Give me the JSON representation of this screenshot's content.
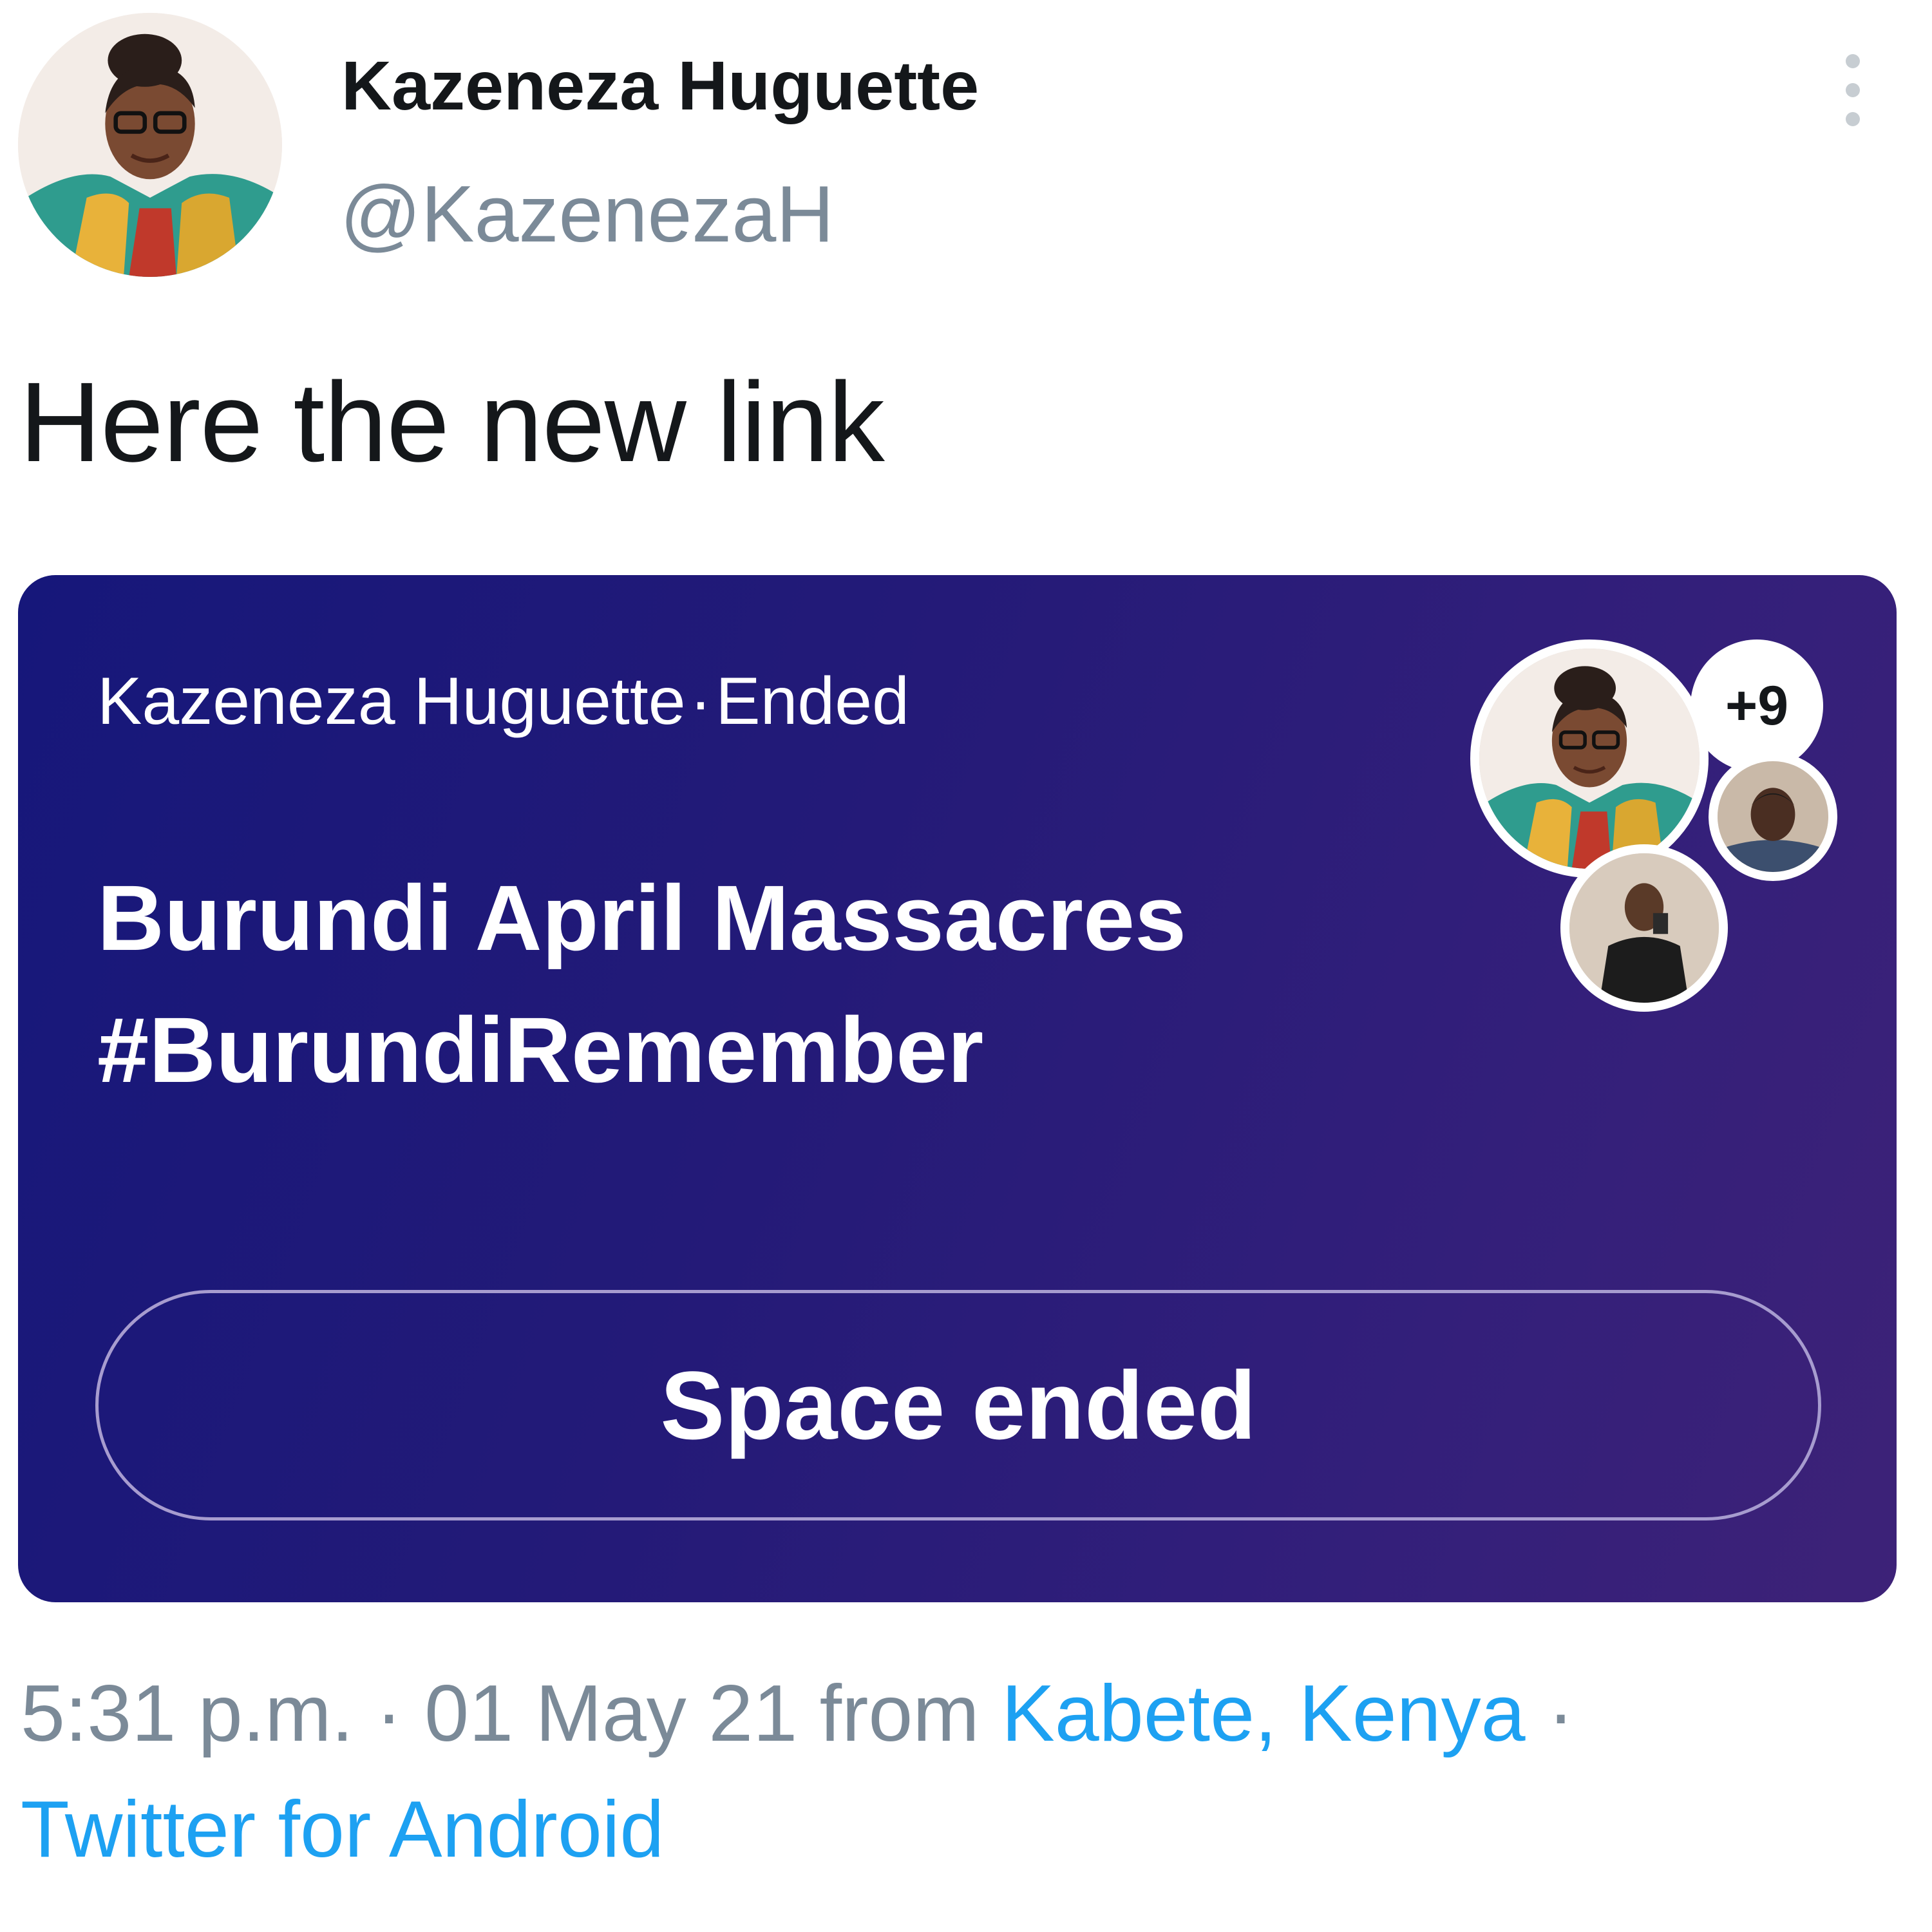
{
  "author": {
    "display_name": "Kazeneza Huguette",
    "handle": "@KazenezaH",
    "avatar_icon": "user-avatar-photo"
  },
  "tweet": {
    "text": "Here the new link"
  },
  "space_card": {
    "host_name": "Kazeneza Huguette",
    "separator": "·",
    "status": "Ended",
    "title_line1": "Burundi April Massacres",
    "title_line2": "#BurundiRemember",
    "extra_speakers_count": "+9",
    "button_label": "Space ended",
    "gradient_colors": [
      "#16177a",
      "#3d2278"
    ]
  },
  "footer": {
    "time": "5:31 p.m.",
    "sep1": " · ",
    "date": "01 May 21",
    "from_word": " from ",
    "location": "Kabete, Kenya",
    "sep2": " ·",
    "source": "Twitter for Android"
  },
  "colors": {
    "link": "#1da1f2",
    "secondary_text": "#7b8a98",
    "primary_text": "#14171a"
  }
}
